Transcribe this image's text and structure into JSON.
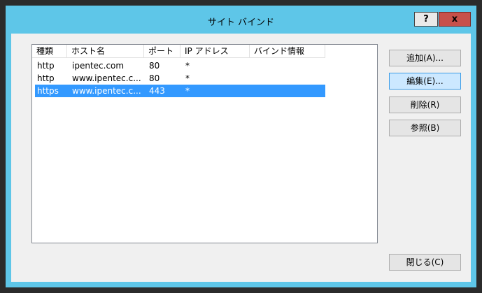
{
  "window": {
    "title": "サイト バインド",
    "help_label": "?",
    "close_label": "x"
  },
  "bindings_list": {
    "columns": [
      "種類",
      "ホスト名",
      "ポート",
      "IP アドレス",
      "バインド情報"
    ],
    "rows": [
      {
        "type": "http",
        "host": "ipentec.com",
        "port": "80",
        "ip": "*",
        "info": "",
        "selected": false
      },
      {
        "type": "http",
        "host": "www.ipentec.c...",
        "port": "80",
        "ip": "*",
        "info": "",
        "selected": false
      },
      {
        "type": "https",
        "host": "www.ipentec.c...",
        "port": "443",
        "ip": "*",
        "info": "",
        "selected": true
      }
    ]
  },
  "buttons": {
    "add": "追加(A)...",
    "edit": "編集(E)...",
    "delete": "削除(R)",
    "browse": "参照(B)",
    "close": "閉じる(C)"
  },
  "colors": {
    "title_bar": "#5ec6e8",
    "selection": "#3399ff",
    "close_button": "#c7504a"
  }
}
